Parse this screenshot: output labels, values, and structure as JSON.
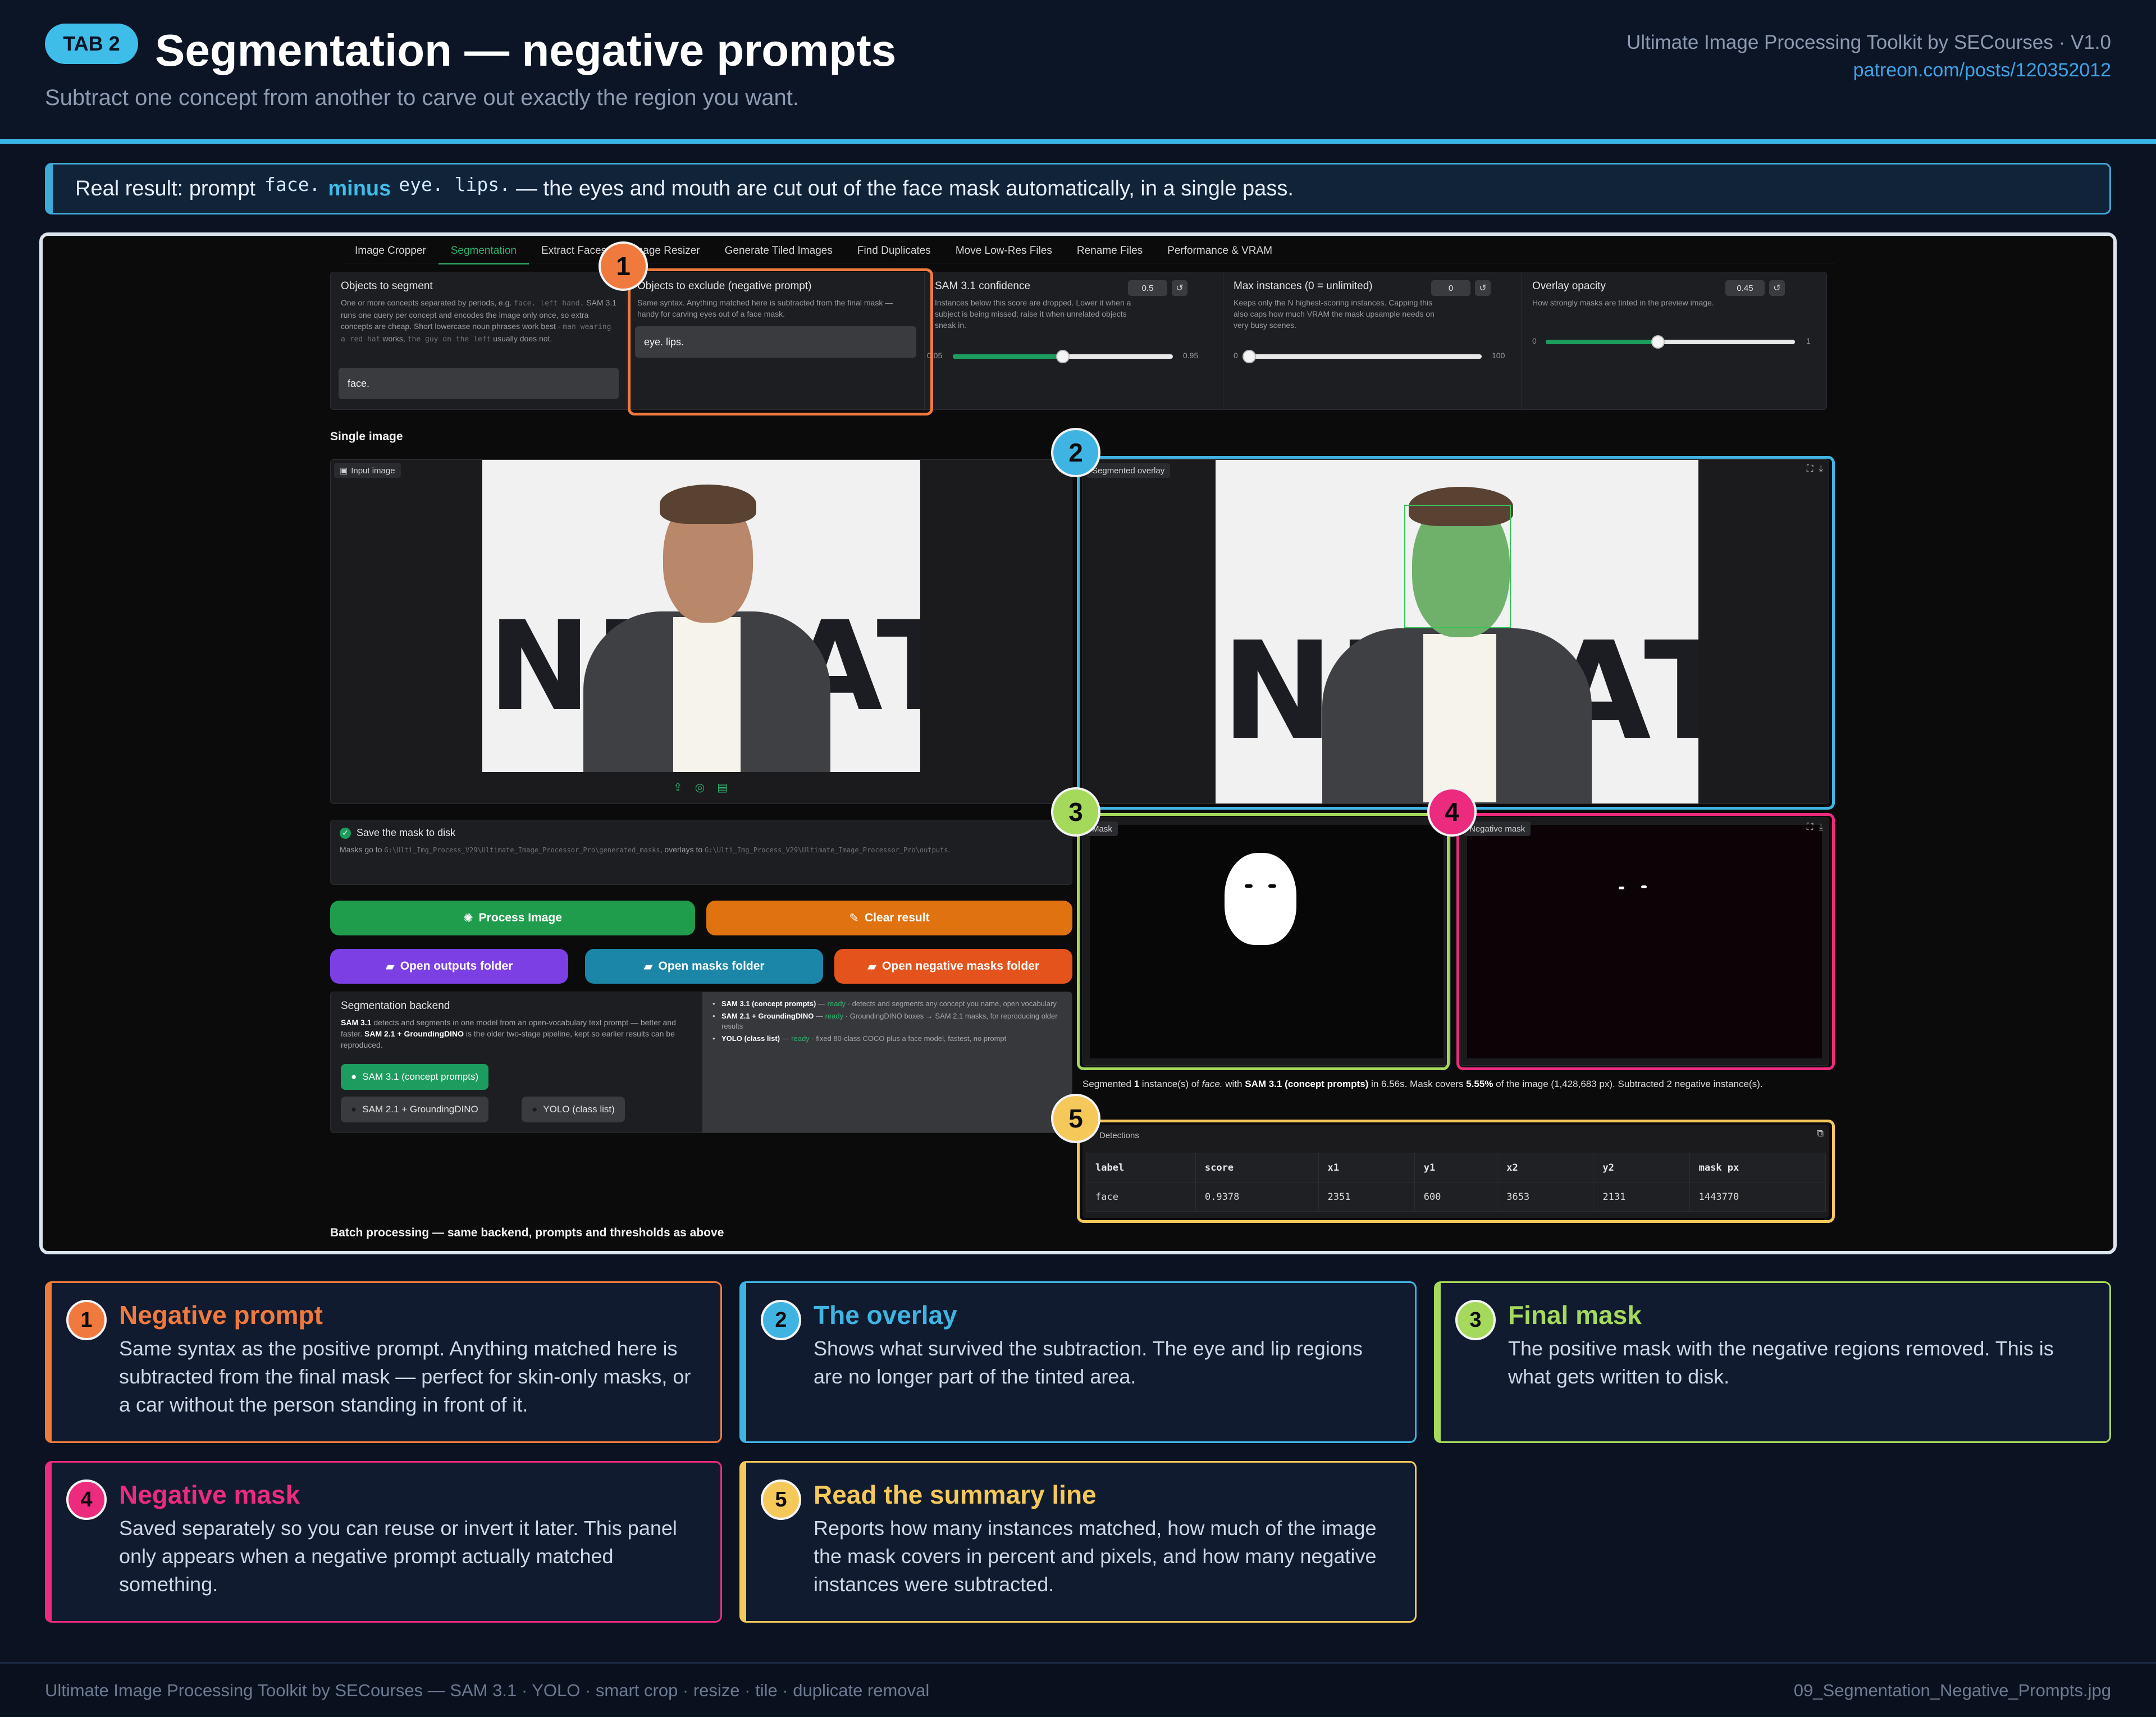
{
  "header": {
    "tab_badge": "TAB 2",
    "title": "Segmentation — negative prompts",
    "subtitle": "Subtract one concept from another to carve out exactly the region you want.",
    "brand": "Ultimate Image Processing Toolkit by SECourses  ·  V1.0",
    "link": "patreon.com/posts/120352012"
  },
  "callout": {
    "prefix": "Real result: prompt",
    "code1": "face.",
    "minus": "minus",
    "code2": "eye. lips.",
    "suffix": "— the eyes and mouth are cut out of the face mask automatically, in a single pass."
  },
  "app": {
    "tabs": [
      "Image Cropper",
      "Segmentation",
      "Extract Faces",
      "Image Resizer",
      "Generate Tiled Images",
      "Find Duplicates",
      "Move Low-Res Files",
      "Rename Files",
      "Performance & VRAM"
    ],
    "objects": {
      "label": "Objects to segment",
      "help_a": "One or more concepts separated by periods, e.g.",
      "help_code1": "face. left hand.",
      "help_b": "SAM 3.1 runs one query per concept and encodes the image only once, so extra concepts are cheap. Short lowercase noun phrases work best -",
      "help_code2": "man wearing a red hat",
      "help_c": "works,",
      "help_code3": "the guy on the left",
      "help_d": "usually does not.",
      "value": "face."
    },
    "exclude": {
      "label": "Objects to exclude (negative prompt)",
      "help": "Same syntax. Anything matched here is subtracted from the final mask — handy for carving eyes out of a face mask.",
      "value": "eye. lips."
    },
    "confidence": {
      "label": "SAM 3.1 confidence",
      "help": "Instances below this score are dropped. Lower it when a subject is being missed; raise it when unrelated objects sneak in.",
      "value": "0.5",
      "min": "0.05",
      "max": "0.95",
      "fraction": 0.5
    },
    "max_instances": {
      "label": "Max instances (0 = unlimited)",
      "help": "Keeps only the N highest-scoring instances. Capping this also caps how much VRAM the mask upsample needs on very busy scenes.",
      "value": "0",
      "min": "0",
      "max": "100",
      "fraction": 0.0
    },
    "opacity": {
      "label": "Overlay opacity",
      "help": "How strongly masks are tinted in the preview image.",
      "value": "0.45",
      "min": "0",
      "max": "1",
      "fraction": 0.45
    },
    "single_image_label": "Single image",
    "input_tag": "Input image",
    "overlay_tag": "Segmented overlay",
    "mask_tag": "Mask",
    "neg_mask_tag": "Negative mask",
    "photo_letters": "NEGATI",
    "save": {
      "label": "Save the mask to disk",
      "help_a": "Masks go to",
      "path1": "G:\\Ulti_Img_Process_V29\\Ultimate_Image_Processor_Pro\\generated_masks",
      "help_b": ", overlays to",
      "path2": "G:\\Ulti_Img_Process_V29\\Ultimate_Image_Processor_Pro\\outputs",
      "help_c": "."
    },
    "buttons": {
      "process": "Process Image",
      "clear": "Clear result",
      "outputs": "Open outputs folder",
      "masks": "Open masks folder",
      "neg_masks": "Open negative masks folder"
    },
    "backend": {
      "label": "Segmentation backend",
      "help_b1": "SAM 3.1",
      "help_a": "detects and segments in one model from an open-vocabulary text prompt — better and faster.",
      "help_b2": "SAM 2.1 + GroundingDINO",
      "help_c": "is the older two-stage pipeline, kept so earlier results can be reproduced.",
      "options": [
        "SAM 3.1 (concept prompts)",
        "SAM 2.1 + GroundingDINO",
        "YOLO (class list)"
      ],
      "selected": "SAM 3.1 (concept prompts)",
      "bullets": [
        {
          "name": "SAM 3.1 (concept prompts)",
          "status": "ready",
          "text": "· detects and segments any concept you name, open vocabulary"
        },
        {
          "name": "SAM 2.1 + GroundingDINO",
          "status": "ready",
          "text": "· GroundingDINO boxes → SAM 2.1 masks, for reproducing older results"
        },
        {
          "name": "YOLO (class list)",
          "status": "ready",
          "text": "· fixed 80-class COCO plus a face model, fastest, no prompt"
        }
      ]
    },
    "summary": {
      "a": "Segmented",
      "count": "1",
      "b": "instance(s) of",
      "concept": "face.",
      "c": "with",
      "backend": "SAM 3.1 (concept prompts)",
      "d": "in 6.56s. Mask covers",
      "pct": "5.55%",
      "e": "of the image (1,428,683 px). Subtracted 2 negative instance(s)."
    },
    "detections": {
      "tag": "Detections",
      "headers": [
        "label",
        "score",
        "x1",
        "y1",
        "x2",
        "y2",
        "mask px"
      ],
      "rows": [
        [
          "face",
          "0.9378",
          "2351",
          "600",
          "3653",
          "2131",
          "1443770"
        ]
      ]
    },
    "batch_label": "Batch processing — same backend, prompts and thresholds as above"
  },
  "cards": [
    {
      "n": "1",
      "title": "Negative prompt",
      "text": "Same syntax as the positive prompt. Anything matched here is subtracted from the final mask — perfect for skin-only masks, or a car without the person standing in front of it.",
      "color": "#f07a3e"
    },
    {
      "n": "2",
      "title": "The overlay",
      "text": "Shows what survived the subtraction. The eye and lip regions are no longer part of the tinted area.",
      "color": "#3fb4e3"
    },
    {
      "n": "3",
      "title": "Final mask",
      "text": "The positive mask with the negative regions removed. This is what gets written to disk.",
      "color": "#a5d95c"
    },
    {
      "n": "4",
      "title": "Negative mask",
      "text": "Saved separately so you can reuse or invert it later. This panel only appears when a negative prompt actually matched something.",
      "color": "#ec2b7e"
    },
    {
      "n": "5",
      "title": "Read the summary line",
      "text": "Reports how many instances matched, how much of the image the mask covers in percent and pixels, and how many negative instances were subtracted.",
      "color": "#f5c85a"
    }
  ],
  "markers": [
    "1",
    "2",
    "3",
    "4",
    "5"
  ],
  "footer": {
    "left": "Ultimate Image Processing Toolkit by SECourses — SAM 3.1 · YOLO · smart crop · resize · tile · duplicate removal",
    "right": "09_Segmentation_Negative_Prompts.jpg"
  },
  "colors": {
    "orange": "#f07a3e",
    "blue": "#3fb4e3",
    "green": "#a5d95c",
    "pink": "#ec2b7e",
    "yellow": "#f5c85a",
    "process_button": "#1f9d4d",
    "clear_button": "#e0720f",
    "outputs_button": "#7b3fe4",
    "masks_button": "#1b86a7",
    "neg_masks_button": "#e5531d"
  }
}
